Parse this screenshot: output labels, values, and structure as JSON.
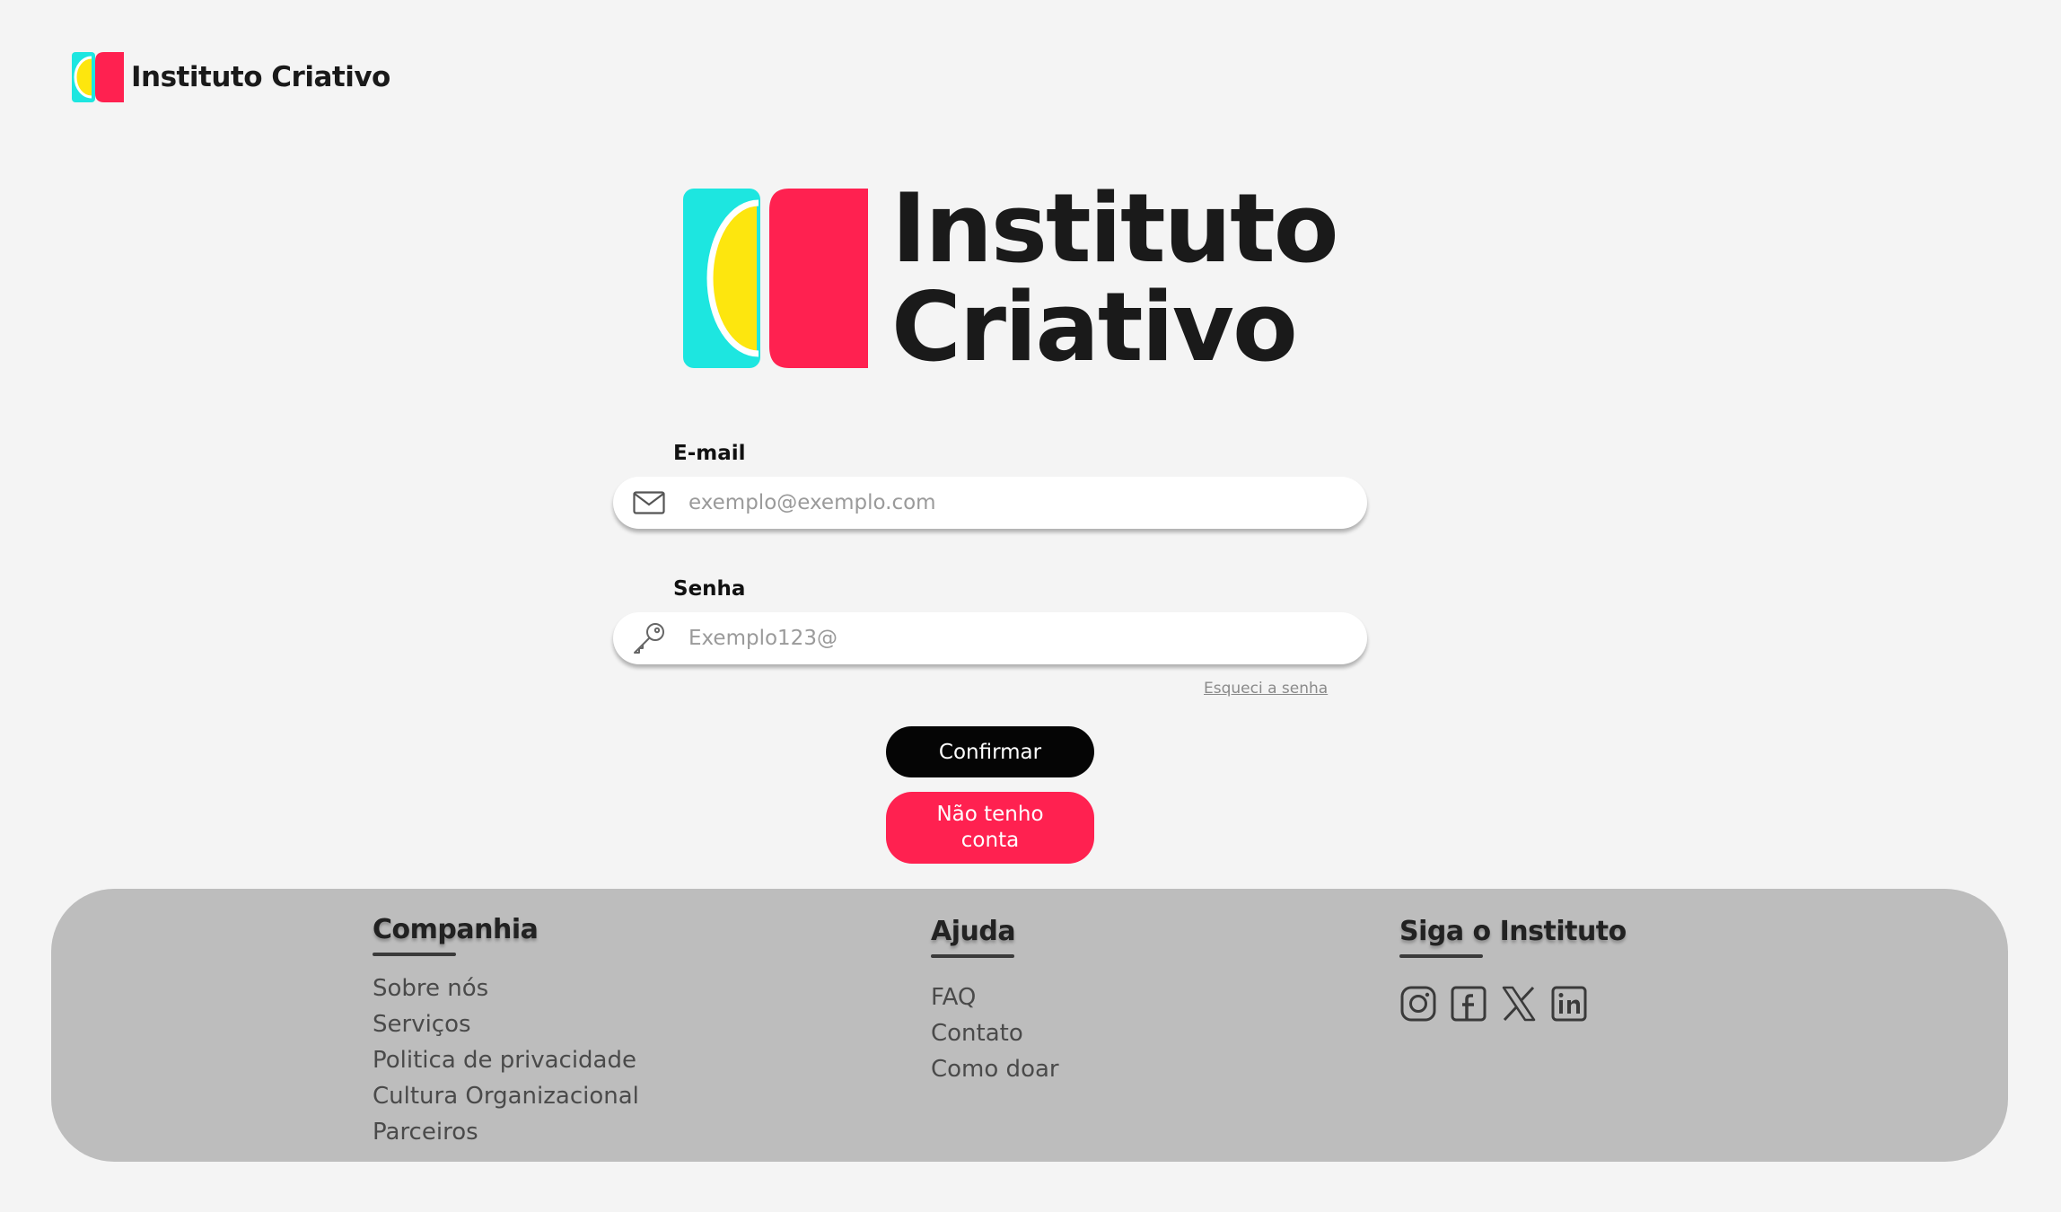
{
  "header": {
    "brand": "Instituto Criativo"
  },
  "hero": {
    "line1": "Instituto",
    "line2": "Criativo"
  },
  "brand_colors": {
    "cyan": "#1de6e0",
    "yellow": "#fde60e",
    "red": "#ff2150"
  },
  "form": {
    "email_label": "E-mail",
    "email_placeholder": "exemplo@exemplo.com",
    "email_icon": "envelope-icon",
    "password_label": "Senha",
    "password_placeholder": "Exemplo123@",
    "password_icon": "key-icon",
    "forgot_label": "Esqueci a senha",
    "confirm_label": "Confirmar",
    "no_account_label": "Não tenho conta"
  },
  "footer": {
    "company": {
      "title": "Companhia",
      "links": [
        "Sobre nós",
        "Serviços",
        "Politica de privacidade",
        "Cultura Organizacional",
        "Parceiros"
      ]
    },
    "help": {
      "title": "Ajuda",
      "links": [
        "FAQ",
        "Contato",
        "Como doar"
      ]
    },
    "follow": {
      "title": "Siga o Instituto",
      "icons": [
        "instagram-icon",
        "facebook-icon",
        "x-icon",
        "linkedin-icon"
      ]
    }
  }
}
